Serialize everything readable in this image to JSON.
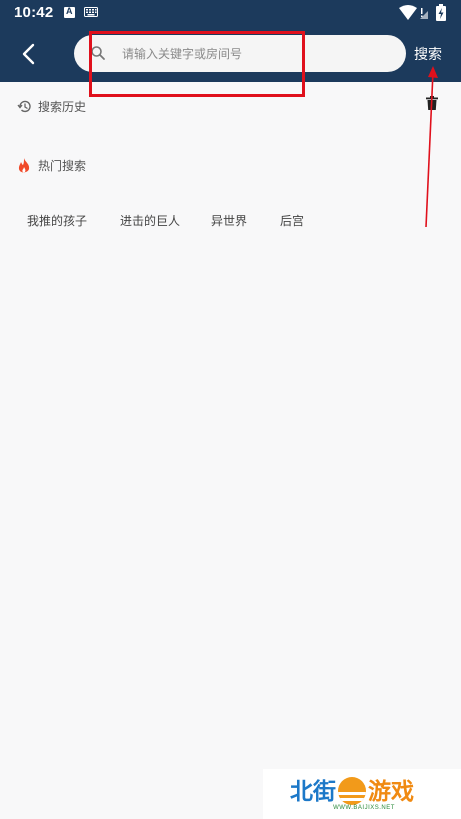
{
  "status_bar": {
    "time": "10:42",
    "icons": [
      "a-notification-icon",
      "keyboard-icon",
      "wifi-icon",
      "battery-charging-icon"
    ]
  },
  "header": {
    "back_icon": "chevron-left-icon",
    "search": {
      "placeholder": "请输入关键字或房间号",
      "value": "",
      "icon": "search-icon"
    },
    "submit_label": "搜索"
  },
  "history": {
    "title": "搜索历史",
    "icon": "history-clock-icon",
    "clear_icon": "trash-icon"
  },
  "hot": {
    "title": "热门搜索",
    "icon": "fire-icon",
    "tags": [
      "我推的孩子",
      "进击的巨人",
      "异世界",
      "后宫"
    ]
  },
  "colors": {
    "header_bg": "#1c3a5c",
    "page_bg": "#f8f8f9",
    "annotation_red": "#e0101c",
    "fire_red": "#f04a2a"
  },
  "watermark": {
    "logo_left": "北街",
    "logo_right": "游戏",
    "url": "WWW.BAIJIXS.NET"
  }
}
